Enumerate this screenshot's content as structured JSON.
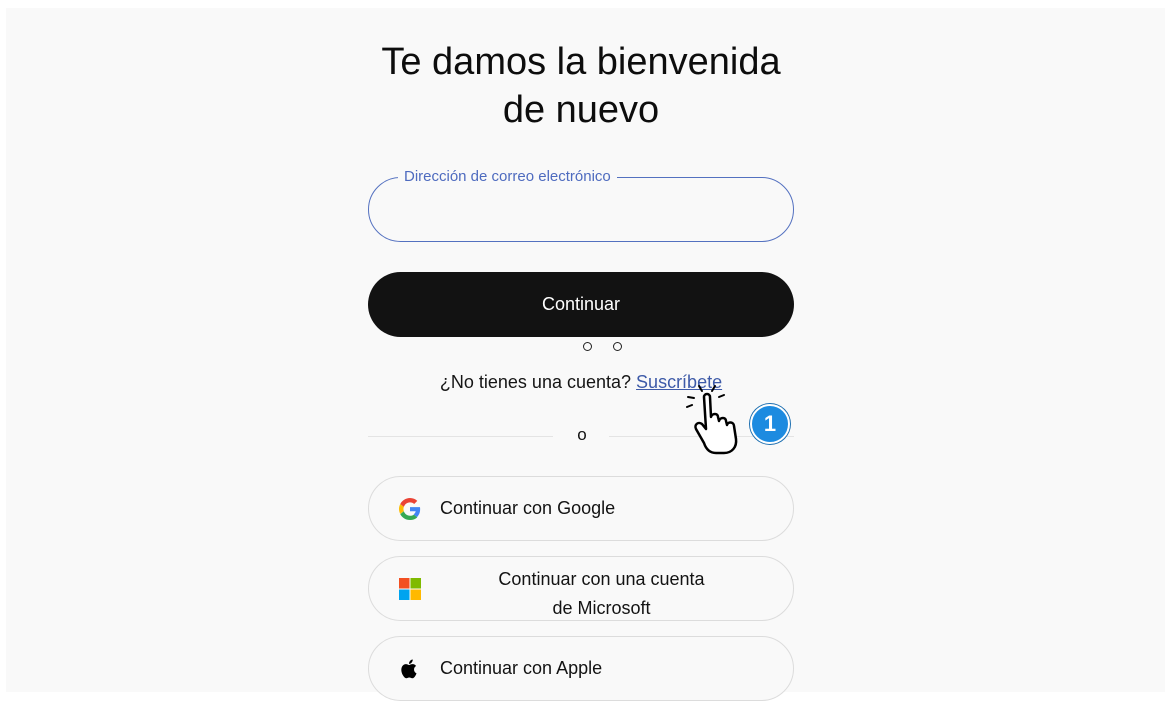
{
  "title": {
    "line1": "Te damos la bienvenida",
    "line2": "de nuevo"
  },
  "email": {
    "label": "Dirección de correo electrónico",
    "value": "",
    "placeholder": ""
  },
  "continue_label": "Continuar",
  "signup": {
    "prompt": "¿No tienes una cuenta?",
    "link": "Suscríbete"
  },
  "divider": "o",
  "social": {
    "google": {
      "label": "Continuar con Google",
      "icon": "google-icon"
    },
    "microsoft": {
      "line1": "Continuar con una cuenta",
      "line2": "de Microsoft",
      "icon": "microsoft-icon"
    },
    "apple": {
      "label": "Continuar con Apple",
      "icon": "apple-icon"
    }
  },
  "annotation": {
    "step": "1",
    "icon": "hand-pointer-icon",
    "badge_color": "#1d8be0"
  },
  "colors": {
    "primary_button": "#121212",
    "accent": "#4e6bbf",
    "background": "#f9f9f9"
  }
}
